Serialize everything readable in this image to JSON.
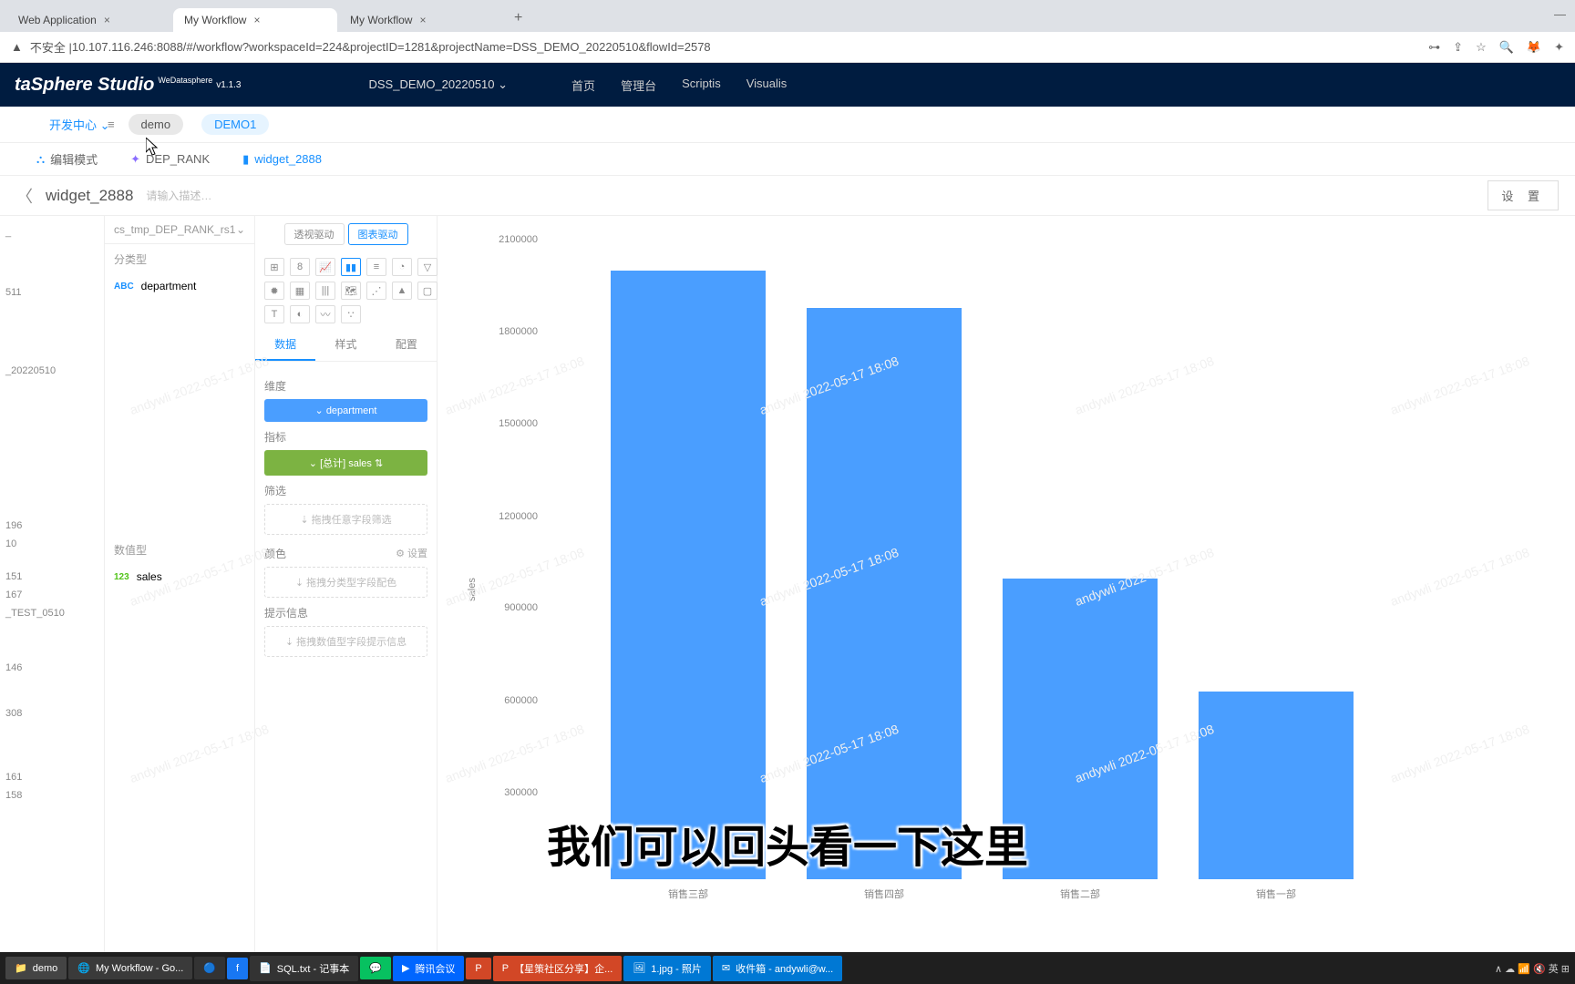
{
  "browser": {
    "tabs": [
      {
        "title": "Web Application",
        "active": false
      },
      {
        "title": "My Workflow",
        "active": true
      },
      {
        "title": "My Workflow",
        "active": false
      }
    ],
    "url_prefix": "不安全 | ",
    "url": "10.107.116.246:8088/#/workflow?workspaceId=224&projectID=1281&projectName=DSS_DEMO_20220510&flowId=2578"
  },
  "app": {
    "logo": "taSphere Studio",
    "logo_sup": "WeDatasphere",
    "version": "v1.1.3",
    "project": "DSS_DEMO_20220510",
    "nav": [
      "首页",
      "管理台",
      "Scriptis",
      "Visualis"
    ]
  },
  "crumb": {
    "dev_center": "开发中心",
    "pills": [
      "demo",
      "DEMO1"
    ]
  },
  "subtabs": [
    {
      "label": "编辑模式",
      "icon": "tree"
    },
    {
      "label": "DEP_RANK",
      "icon": "star"
    },
    {
      "label": "widget_2888",
      "icon": "widget",
      "active": true
    }
  ],
  "title": {
    "name": "widget_2888",
    "desc_placeholder": "请输入描述…",
    "settings": "设 置"
  },
  "left_tree": [
    "_",
    "511",
    "_20220510",
    "196",
    "10",
    "151",
    "167",
    "_TEST_0510",
    "146",
    "308",
    "161",
    "158"
  ],
  "datasource": "cs_tmp_DEP_RANK_rs1",
  "fields": {
    "cat_header": "分类型",
    "cat_items": [
      {
        "type": "ABC",
        "name": "department"
      }
    ],
    "num_header": "数值型",
    "num_items": [
      {
        "type": "123",
        "name": "sales"
      }
    ]
  },
  "drive": {
    "opt1": "透视驱动",
    "opt2": "图表驱动"
  },
  "cfg_tabs": [
    "数据",
    "样式",
    "配置"
  ],
  "cfg": {
    "dim_label": "维度",
    "dim_chip": "department",
    "metric_label": "指标",
    "metric_chip": "[总计] sales ⇅",
    "filter_label": "筛选",
    "filter_drop": "拖拽任意字段筛选",
    "color_label": "颜色",
    "color_set": "设置",
    "color_drop": "拖拽分类型字段配色",
    "tip_label": "提示信息",
    "tip_drop": "拖拽数值型字段提示信息"
  },
  "chart_data": {
    "type": "bar",
    "ylabel": "sales",
    "ylim": [
      0,
      2100000
    ],
    "yticks": [
      300000,
      600000,
      900000,
      1200000,
      1500000,
      1800000,
      2100000
    ],
    "categories": [
      "销售三部",
      "销售四部",
      "销售二部",
      "销售一部"
    ],
    "values": [
      1980000,
      1860000,
      980000,
      610000
    ]
  },
  "subtitle": "我们可以回头看一下这里",
  "taskbar": {
    "items": [
      {
        "label": "demo",
        "icon": "folder"
      },
      {
        "label": "My Workflow - Go...",
        "icon": "chrome"
      },
      {
        "label": "",
        "icon": "edge"
      },
      {
        "label": "",
        "icon": "fb"
      },
      {
        "label": "SQL.txt - 记事本",
        "icon": "notepad"
      },
      {
        "label": "",
        "icon": "wechat"
      },
      {
        "label": "腾讯会议",
        "icon": "meeting"
      },
      {
        "label": "",
        "icon": "ppt-app"
      },
      {
        "label": "【星策社区分享】企...",
        "icon": "ppt"
      },
      {
        "label": "1.jpg - 照片",
        "icon": "photo"
      },
      {
        "label": "收件箱 - andywli@w...",
        "icon": "outlook"
      }
    ],
    "tray": "∧ ☁ 📶 🔇 英 ⊞"
  }
}
